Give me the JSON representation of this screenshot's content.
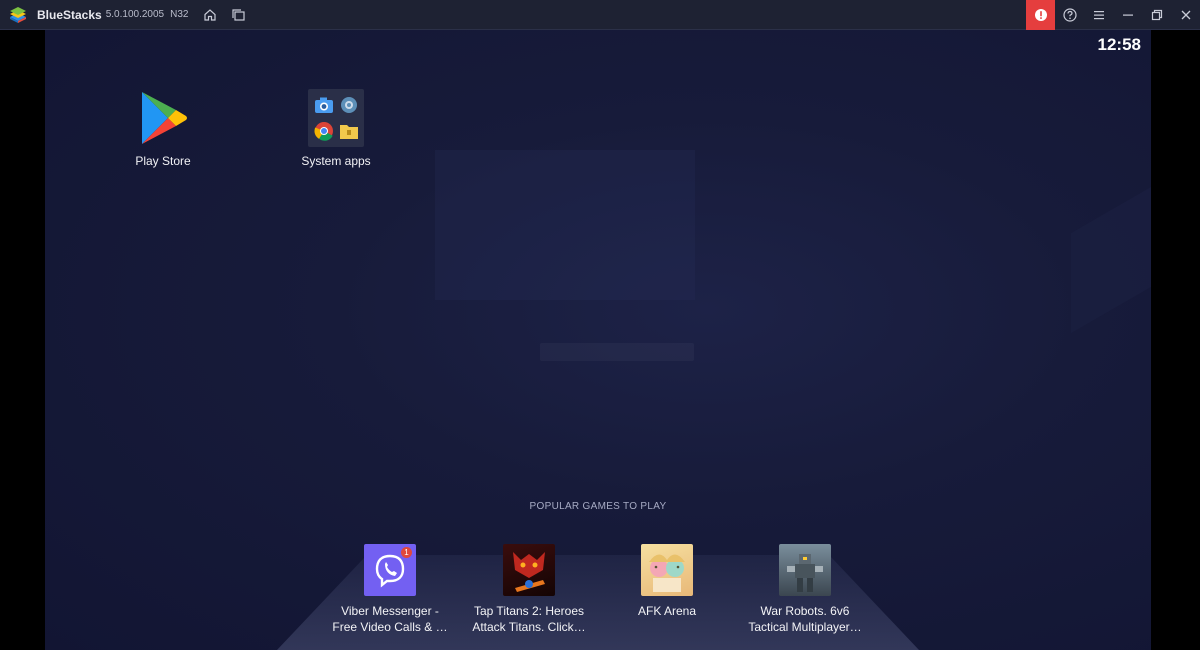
{
  "titlebar": {
    "app_name": "BlueStacks",
    "version": "5.0.100.2005",
    "build": "N32",
    "icons": [
      "home-icon",
      "multi-instance-icon",
      "alert-icon",
      "help-icon",
      "menu-icon",
      "minimize-icon",
      "restore-icon",
      "close-icon"
    ]
  },
  "screen": {
    "clock": "12:58",
    "desktop_apps": [
      {
        "label": "Play Store",
        "icon": "play-store-icon"
      },
      {
        "label": "System apps",
        "icon": "system-apps-folder-icon"
      }
    ],
    "popular": {
      "title": "POPULAR GAMES TO PLAY",
      "games": [
        {
          "line1": "Viber Messenger -",
          "line2": "Free Video Calls & …",
          "badge": "1"
        },
        {
          "line1": "Tap Titans 2: Heroes",
          "line2": "Attack Titans. Click…"
        },
        {
          "line1": "AFK Arena",
          "line2": ""
        },
        {
          "line1": "War Robots. 6v6",
          "line2": "Tactical Multiplayer…"
        }
      ]
    }
  },
  "colors": {
    "titlebar_bg": "#1e2233",
    "alert_red": "#e53e3e",
    "screen_bg": "#171b3a",
    "viber_purple": "#7360f2"
  }
}
